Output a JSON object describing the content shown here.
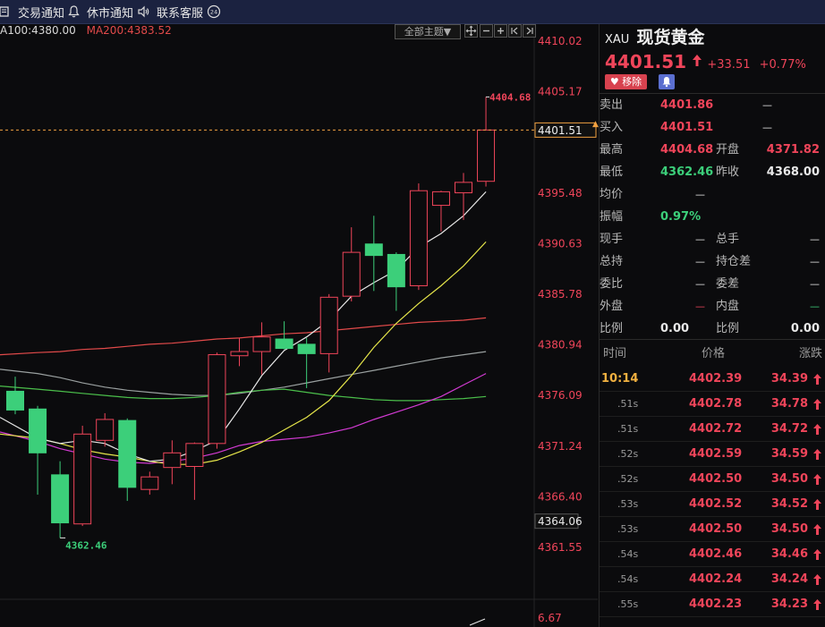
{
  "topbar": {
    "items": [
      {
        "label": "交易通知",
        "icon": "bell-icon"
      },
      {
        "label": "休市通知",
        "icon": "speaker-icon"
      },
      {
        "label": "联系客服",
        "icon": "headset-icon"
      }
    ]
  },
  "chart": {
    "ma_labels": [
      "A100:4380.00",
      "MA200:4383.52"
    ],
    "theme_button": "全部主题▼",
    "price_axis": [
      "4410.02",
      "4405.17",
      "4395.48",
      "4390.63",
      "4385.78",
      "4380.94",
      "4376.09",
      "4371.24",
      "4366.40",
      "4361.55"
    ],
    "current_price_tag": "4401.51",
    "low_price_tag": "4364.06",
    "high_label": "4404.68",
    "low_label": "4362.46",
    "sub_axis_value": "6.67",
    "colors": {
      "up": "#f0455a",
      "down": "#3ccf7a",
      "ma_white": "#e8e8e8",
      "ma_yellow": "#e6e64a",
      "ma_magenta": "#d23ad2",
      "ma_green": "#4bbf4b",
      "ma_red": "#e24a4a",
      "ma_grey": "#9aa0a0"
    }
  },
  "chart_data": {
    "type": "candlestick",
    "ylim": [
      4361.55,
      4410.02
    ],
    "x": [
      1,
      2,
      3,
      4,
      5,
      6,
      7,
      8,
      9,
      10,
      11,
      12,
      13,
      14,
      15,
      16,
      17,
      18,
      19,
      20,
      21,
      22
    ],
    "ohlc": [
      [
        4376.5,
        4377.9,
        4374.3,
        4374.7
      ],
      [
        4374.8,
        4375.1,
        4366.6,
        4370.6
      ],
      [
        4368.5,
        4369.8,
        4362.46,
        4363.9
      ],
      [
        4363.8,
        4373.2,
        4363.6,
        4372.4
      ],
      [
        4371.8,
        4374.4,
        4371.2,
        4373.8
      ],
      [
        4373.7,
        4373.9,
        4366.0,
        4367.3
      ],
      [
        4367.1,
        4368.8,
        4366.6,
        4368.3
      ],
      [
        4369.2,
        4371.8,
        4367.6,
        4370.6
      ],
      [
        4369.3,
        4371.6,
        4366.1,
        4371.5
      ],
      [
        4371.5,
        4380.2,
        4371.0,
        4380.0
      ],
      [
        4379.9,
        4381.6,
        4378.9,
        4380.3
      ],
      [
        4380.3,
        4383.1,
        4378.1,
        4381.7
      ],
      [
        4381.5,
        4383.2,
        4380.5,
        4380.6
      ],
      [
        4381.0,
        4381.6,
        4376.8,
        4380.1
      ],
      [
        4380.1,
        4385.8,
        4378.3,
        4385.5
      ],
      [
        4385.6,
        4392.2,
        4385.1,
        4389.8
      ],
      [
        4390.6,
        4393.3,
        4386.1,
        4389.5
      ],
      [
        4389.6,
        4389.8,
        4384.2,
        4386.5
      ],
      [
        4386.6,
        4396.4,
        4386.2,
        4395.7
      ],
      [
        4394.3,
        4395.7,
        4391.8,
        4395.6
      ],
      [
        4395.5,
        4397.4,
        4392.9,
        4396.5
      ],
      [
        4396.6,
        4404.68,
        4396.1,
        4401.51
      ]
    ],
    "ma_series": [
      {
        "name": "MA200",
        "values": [
          4380.0,
          4380.2,
          4380.3,
          4380.5,
          4380.6,
          4380.8,
          4381.0,
          4381.1,
          4381.3,
          4381.5,
          4381.6,
          4381.8,
          4382.0,
          4382.1,
          4382.3,
          4382.5,
          4382.7,
          4382.9,
          4383.1,
          4383.2,
          4383.3,
          4383.52
        ]
      },
      {
        "name": "",
        "values": [
          4378.6,
          4378.2,
          4377.8,
          4377.3,
          4376.9,
          4376.6,
          4376.4,
          4376.2,
          4376.1,
          4376.1,
          4376.3,
          4376.6,
          4376.9,
          4377.3,
          4377.7,
          4378.1,
          4378.5,
          4378.9,
          4379.3,
          4379.7,
          4380.0,
          4380.3
        ]
      },
      {
        "name": "",
        "values": [
          4377.0,
          4376.7,
          4376.5,
          4376.3,
          4376.1,
          4375.9,
          4375.8,
          4375.8,
          4375.9,
          4376.1,
          4376.4,
          4376.6,
          4376.7,
          4376.4,
          4376.1,
          4375.9,
          4375.7,
          4375.6,
          4375.6,
          4375.7,
          4375.8,
          4376.0
        ]
      },
      {
        "name": "",
        "values": [
          4372.6,
          4371.7,
          4371.0,
          4370.5,
          4370.0,
          4369.7,
          4369.6,
          4369.8,
          4370.1,
          4370.6,
          4371.3,
          4371.7,
          4371.9,
          4372.1,
          4372.5,
          4373.0,
          4373.8,
          4374.5,
          4375.2,
          4376.0,
          4377.1,
          4378.2
        ]
      },
      {
        "name": "",
        "values": [
          4372.4,
          4372.0,
          4371.5,
          4370.9,
          4370.5,
          4370.2,
          4369.8,
          4369.5,
          4369.5,
          4369.9,
          4370.7,
          4371.6,
          4372.8,
          4374.0,
          4375.6,
          4378.0,
          4380.7,
          4383.0,
          4384.9,
          4386.6,
          4388.5,
          4390.8
        ]
      },
      {
        "name": "",
        "values": [
          4374.0,
          4372.0,
          4371.5,
          4371.8,
          4371.5,
          4370.5,
          4369.8,
          4370.0,
          4370.8,
          4371.8,
          4374.8,
          4378.0,
          4380.4,
          4381.7,
          4383.3,
          4385.6,
          4386.9,
          4388.1,
          4390.3,
          4391.6,
          4393.3,
          4395.6
        ]
      }
    ]
  },
  "panel": {
    "symbol": "XAU",
    "name": "现货黄金",
    "price": "4401.51",
    "change": "+33.51",
    "change_pct": "+0.77%",
    "remove_label": "移除",
    "stats": [
      {
        "l1": "卖出",
        "v1": "4401.86",
        "v1c": "red",
        "l2": "",
        "v2": "",
        "v2c": "white"
      },
      {
        "l1": "买入",
        "v1": "4401.51",
        "v1c": "red",
        "l2": "",
        "v2": "",
        "v2c": "white"
      },
      {
        "l1": "最高",
        "v1": "4404.68",
        "v1c": "red",
        "l2": "开盘",
        "v2": "4371.82",
        "v2c": "red"
      },
      {
        "l1": "最低",
        "v1": "4362.46",
        "v1c": "green",
        "l2": "昨收",
        "v2": "4368.00",
        "v2c": "white"
      },
      {
        "l1": "均价",
        "v1": "",
        "v1c": "white",
        "l2": "",
        "v2": "",
        "v2c": "white"
      },
      {
        "l1": "振幅",
        "v1": "0.97%",
        "v1c": "green",
        "l2": "",
        "v2": "",
        "v2c": "white"
      },
      {
        "l1": "现手",
        "v1": "",
        "v1c": "white",
        "l2": "总手",
        "v2": "",
        "v2c": "white"
      },
      {
        "l1": "总持",
        "v1": "",
        "v1c": "white",
        "l2": "持仓差",
        "v2": "",
        "v2c": "white"
      },
      {
        "l1": "委比",
        "v1": "",
        "v1c": "white",
        "l2": "委差",
        "v2": "",
        "v2c": "white"
      },
      {
        "l1": "外盘",
        "v1": "",
        "v1c": "red",
        "l2": "内盘",
        "v2": "",
        "v2c": "green"
      },
      {
        "l1": "比例",
        "v1": "0.00",
        "v1c": "white",
        "l2": "比例",
        "v2": "0.00",
        "v2c": "white"
      }
    ],
    "dash_cells": [
      [
        0,
        1
      ],
      [
        1,
        1
      ],
      [
        4,
        0
      ],
      [
        6,
        0
      ],
      [
        6,
        1
      ],
      [
        7,
        0
      ],
      [
        7,
        1
      ],
      [
        8,
        0
      ],
      [
        8,
        1
      ],
      [
        9,
        0
      ],
      [
        9,
        1
      ]
    ],
    "ticks_header": [
      "时间",
      "价格",
      "涨跌"
    ],
    "ticks": [
      {
        "time": "10:14",
        "price": "4402.39",
        "chg": "34.39"
      },
      {
        "time": ".51s",
        "price": "4402.78",
        "chg": "34.78"
      },
      {
        "time": ".51s",
        "price": "4402.72",
        "chg": "34.72"
      },
      {
        "time": ".52s",
        "price": "4402.59",
        "chg": "34.59"
      },
      {
        "time": ".52s",
        "price": "4402.50",
        "chg": "34.50"
      },
      {
        "time": ".53s",
        "price": "4402.52",
        "chg": "34.52"
      },
      {
        "time": ".53s",
        "price": "4402.50",
        "chg": "34.50"
      },
      {
        "time": ".54s",
        "price": "4402.46",
        "chg": "34.46"
      },
      {
        "time": ".54s",
        "price": "4402.24",
        "chg": "34.24"
      },
      {
        "time": ".55s",
        "price": "4402.23",
        "chg": "34.23"
      }
    ]
  }
}
